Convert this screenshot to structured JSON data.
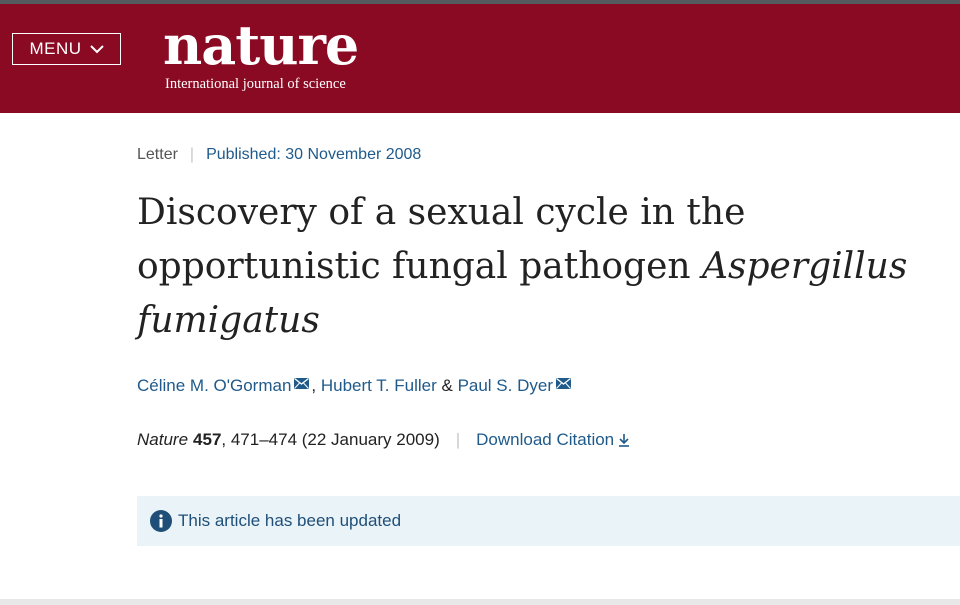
{
  "colors": {
    "brand": "#8b0a23",
    "link": "#1f5a8a",
    "notice_bg": "#eaf3f8"
  },
  "header": {
    "menu_label": "MENU",
    "menu_icon": "chevron-down-icon",
    "logo": "nature",
    "tagline": "International journal of science"
  },
  "article": {
    "type": "Letter",
    "published": "Published: 30 November 2008",
    "title_main": "Discovery of a sexual cycle in the opportunistic fungal pathogen ",
    "title_species": "Aspergillus fumigatus",
    "authors": [
      {
        "name": "Céline M. O'Gorman",
        "has_email": true
      },
      {
        "name": "Hubert T. Fuller",
        "has_email": false
      },
      {
        "name": "Paul S. Dyer",
        "has_email": true
      }
    ],
    "author_sep_1": ", ",
    "author_sep_2": " & ",
    "journal": "Nature",
    "volume": "457",
    "pages_date": ", 471–474 (22 January 2009)",
    "download_citation": "Download Citation",
    "download_icon": "download-arrow-icon",
    "update_notice": "This article has been updated",
    "notice_icon": "info-icon"
  }
}
